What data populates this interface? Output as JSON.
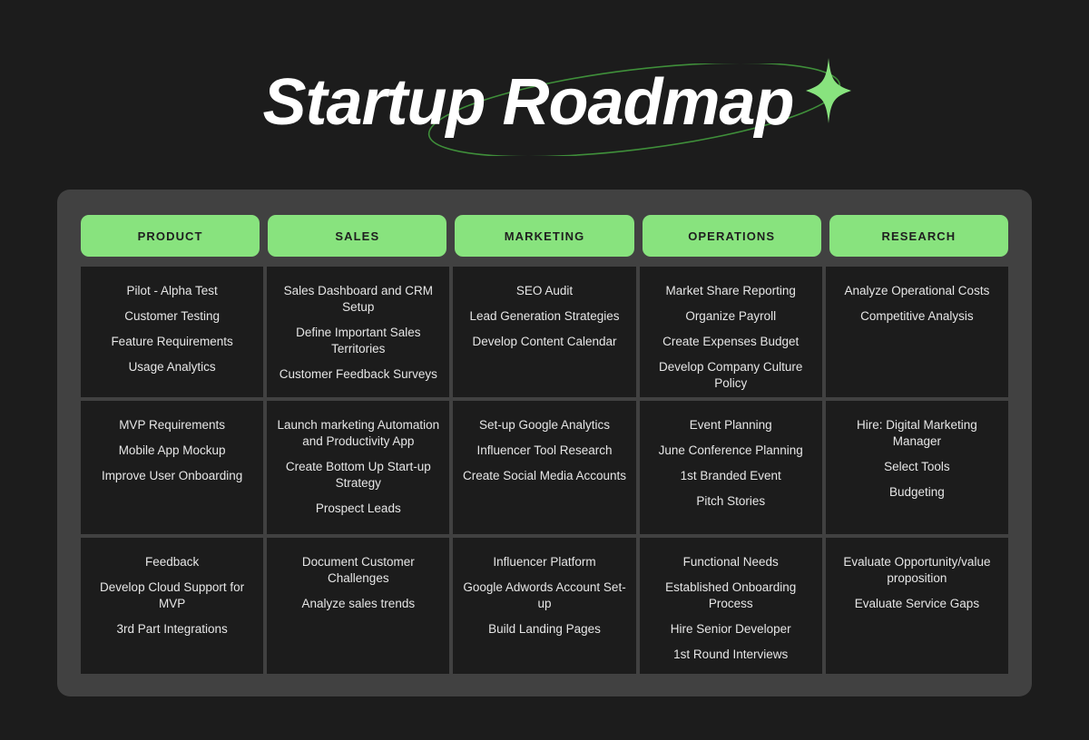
{
  "header": {
    "title": "Startup Roadmap"
  },
  "theme": {
    "page_background": "#1c1c1c",
    "panel_background": "#414141",
    "card_background": "#1c1c1c",
    "accent_green": "#88e37e",
    "header_text": "#1f1f1f",
    "task_text": "#e6e6e6",
    "title_text": "#ffffff"
  },
  "board": {
    "columns": [
      {
        "label": "PRODUCT"
      },
      {
        "label": "SALES"
      },
      {
        "label": "MARKETING"
      },
      {
        "label": "OPERATIONS"
      },
      {
        "label": "RESEARCH"
      }
    ],
    "rows": [
      {
        "cells": [
          {
            "tasks": [
              "Pilot - Alpha Test",
              "Customer Testing",
              "Feature Requirements",
              "Usage Analytics"
            ]
          },
          {
            "tasks": [
              "Sales Dashboard and CRM Setup",
              "Define Important Sales Territories",
              "Customer Feedback Surveys"
            ]
          },
          {
            "tasks": [
              "SEO Audit",
              "Lead Generation Strategies",
              "Develop Content Calendar"
            ]
          },
          {
            "tasks": [
              "Market Share Reporting",
              "Organize Payroll",
              "Create Expenses Budget",
              "Develop Company Culture Policy"
            ]
          },
          {
            "tasks": [
              "Analyze Operational Costs",
              "Competitive Analysis"
            ]
          }
        ]
      },
      {
        "cells": [
          {
            "tasks": [
              "MVP Requirements",
              "Mobile App Mockup",
              "Improve User Onboarding"
            ]
          },
          {
            "tasks": [
              "Launch marketing Automation and Productivity App",
              "Create Bottom Up Start-up Strategy",
              "Prospect Leads"
            ]
          },
          {
            "tasks": [
              "Set-up Google Analytics",
              "Influencer Tool Research",
              "Create Social Media Accounts"
            ]
          },
          {
            "tasks": [
              "Event Planning",
              "June Conference Planning",
              "1st Branded Event",
              "Pitch Stories"
            ]
          },
          {
            "tasks": [
              "Hire: Digital Marketing Manager",
              "Select Tools",
              "Budgeting"
            ]
          }
        ]
      },
      {
        "cells": [
          {
            "tasks": [
              "Feedback",
              "Develop Cloud Support for MVP",
              "3rd Part Integrations"
            ]
          },
          {
            "tasks": [
              "Document Customer Challenges",
              "Analyze sales trends"
            ]
          },
          {
            "tasks": [
              "Influencer Platform",
              "Google Adwords Account Set-up",
              "Build Landing Pages"
            ]
          },
          {
            "tasks": [
              "Functional Needs",
              "Established Onboarding Process",
              "Hire Senior Developer",
              "1st Round Interviews"
            ]
          },
          {
            "tasks": [
              "Evaluate Opportunity/value proposition",
              "Evaluate Service Gaps"
            ]
          }
        ]
      }
    ]
  }
}
